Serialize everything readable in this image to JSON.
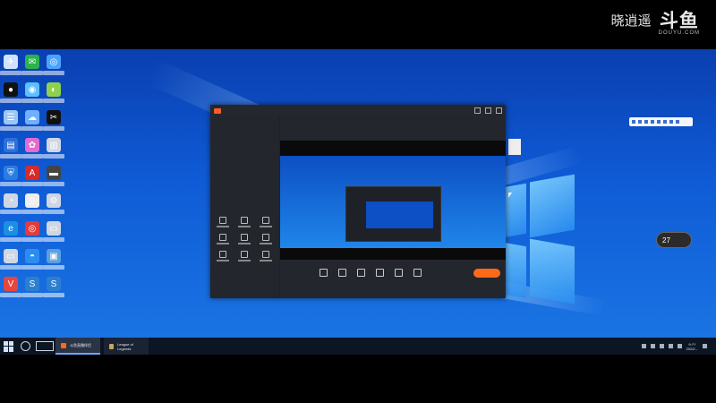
{
  "watermark": {
    "streamer_name": "晓逍遥",
    "platform_logo": "斗鱼",
    "platform_domain": "DOUYU.COM"
  },
  "desktop_icons": [
    {
      "name": "app-icon",
      "color": "#cfe3ff",
      "glyph": "✈"
    },
    {
      "name": "wechat-icon",
      "color": "#2bb24c",
      "glyph": "✉"
    },
    {
      "name": "browser-icon",
      "color": "#4aa3ff",
      "glyph": "◎"
    },
    {
      "name": "qq-icon",
      "color": "#111111",
      "glyph": "●"
    },
    {
      "name": "network-icon",
      "color": "#5bc0ff",
      "glyph": "◉"
    },
    {
      "name": "game-icon",
      "color": "#8fd14f",
      "glyph": "◐"
    },
    {
      "name": "tool-icon",
      "color": "#9cc6f5",
      "glyph": "☰"
    },
    {
      "name": "cloud-icon",
      "color": "#6fb0ff",
      "glyph": "☁"
    },
    {
      "name": "capcut-icon",
      "color": "#111111",
      "glyph": "✂"
    },
    {
      "name": "doc-icon",
      "color": "#2e6fd8",
      "glyph": "▤"
    },
    {
      "name": "color-icon",
      "color": "#e26bd0",
      "glyph": "✿"
    },
    {
      "name": "media-icon",
      "color": "#cfd7e4",
      "glyph": "▥"
    },
    {
      "name": "security-icon",
      "color": "#2a7de1",
      "glyph": "⛨"
    },
    {
      "name": "autocad-icon",
      "color": "#d42b2b",
      "glyph": "A"
    },
    {
      "name": "folder-icon",
      "color": "#444444",
      "glyph": "▬"
    },
    {
      "name": "system-icon",
      "color": "#cfd7e4",
      "glyph": "◔"
    },
    {
      "name": "file-icon",
      "color": "#eeeeee",
      "glyph": "▯"
    },
    {
      "name": "settings-icon",
      "color": "#cfd7e4",
      "glyph": "⚙"
    },
    {
      "name": "edge-icon",
      "color": "#1a8fe3",
      "glyph": "e"
    },
    {
      "name": "target-icon",
      "color": "#e33b3b",
      "glyph": "◎"
    },
    {
      "name": "printer-icon",
      "color": "#cfd7e4",
      "glyph": "▭"
    },
    {
      "name": "monitor-icon",
      "color": "#cfd7e4",
      "glyph": "▭"
    },
    {
      "name": "cloud2-icon",
      "color": "#2a8ef0",
      "glyph": "◓"
    },
    {
      "name": "screen-icon",
      "color": "#5aa0e0",
      "glyph": "▣"
    },
    {
      "name": "valorant-icon",
      "color": "#e8453c",
      "glyph": "V"
    },
    {
      "name": "shield-s-icon",
      "color": "#2c7fd0",
      "glyph": "S"
    },
    {
      "name": "shield-s2-icon",
      "color": "#2c7fd0",
      "glyph": "S"
    }
  ],
  "taskbar": {
    "apps": [
      {
        "label": "斗鱼直播伴侣",
        "icon_color": "#ff6a1a"
      },
      {
        "label": "League of Legends",
        "icon_color": "#c8a75a"
      }
    ],
    "clock_time": "9:??",
    "clock_date": "2022/..."
  },
  "floating_badge": "27"
}
